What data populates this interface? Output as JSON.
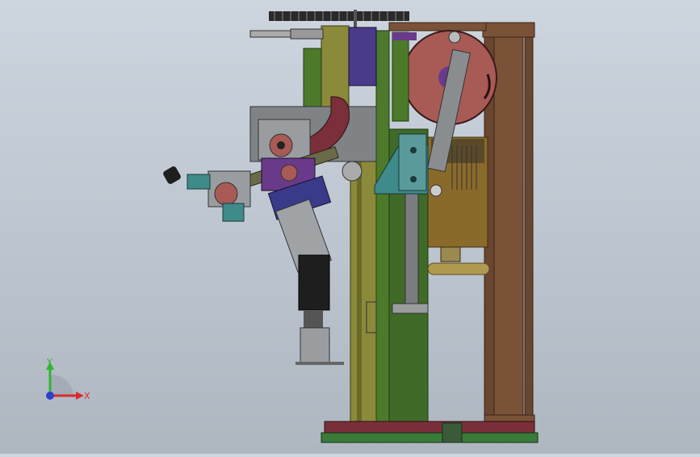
{
  "triad": {
    "y_label": "Y",
    "x_label": "X",
    "y_color": "#2fb52f",
    "x_color": "#d92b2b",
    "z_color": "#2f3fd0"
  },
  "palette": {
    "frame_brown": "#7a5238",
    "frame_green": "#4c7a2a",
    "olive": "#8a8a3a",
    "wheel": "#a85a55",
    "motor_gold": "#8a6a2a",
    "teal": "#3f8a8a",
    "purple": "#6a3a8a",
    "base_red": "#7a2f3a",
    "base_green": "#3a7a3a",
    "steel_gray": "#8a8d90"
  }
}
